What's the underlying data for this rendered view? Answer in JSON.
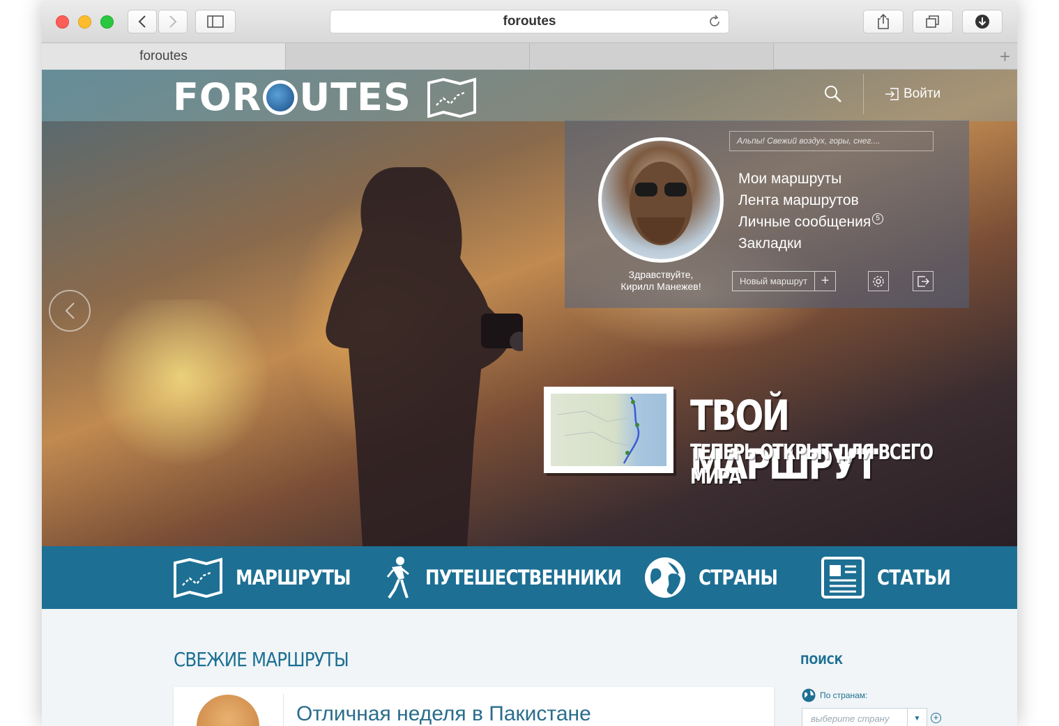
{
  "browser": {
    "address": "foroutes",
    "tabs": [
      {
        "label": "foroutes"
      },
      {
        "label": ""
      },
      {
        "label": ""
      }
    ]
  },
  "header": {
    "logo_left": "FOR",
    "logo_right": "UTES",
    "login": "Войти"
  },
  "user_panel": {
    "search_placeholder": "Альпы! Свежий воздух, горы, снег....",
    "greeting_line1": "Здравствуйте,",
    "greeting_line2": "Кирилл Манежев!",
    "menu": [
      {
        "label": "Мои маршруты"
      },
      {
        "label": "Лента маршрутов"
      },
      {
        "label": "Личные сообщения",
        "badge": "5"
      },
      {
        "label": "Закладки"
      }
    ],
    "new_route": "Новый маршрут"
  },
  "hero": {
    "title": "ТВОЙ МАРШРУТ",
    "subtitle": "ТЕПЕРЬ ОТКРЫТ ДЛЯ ВСЕГО МИРА"
  },
  "nav": {
    "items": [
      {
        "label": "МАРШРУТЫ",
        "icon": "map-icon"
      },
      {
        "label": "ПУТЕШЕСТВЕННИКИ",
        "icon": "hiker-icon"
      },
      {
        "label": "СТРАНЫ",
        "icon": "globe-icon"
      },
      {
        "label": "СТАТЬИ",
        "icon": "newspaper-icon"
      }
    ]
  },
  "content": {
    "section_title": "СВЕЖИЕ МАРШРУТЫ",
    "routes": [
      {
        "title": "Отличная неделя в Пакистане"
      }
    ]
  },
  "sidebar": {
    "title": "ПОИСК",
    "country_label": "По странам:",
    "country_placeholder": "выберите страну"
  },
  "colors": {
    "accent": "#1d6f93"
  }
}
